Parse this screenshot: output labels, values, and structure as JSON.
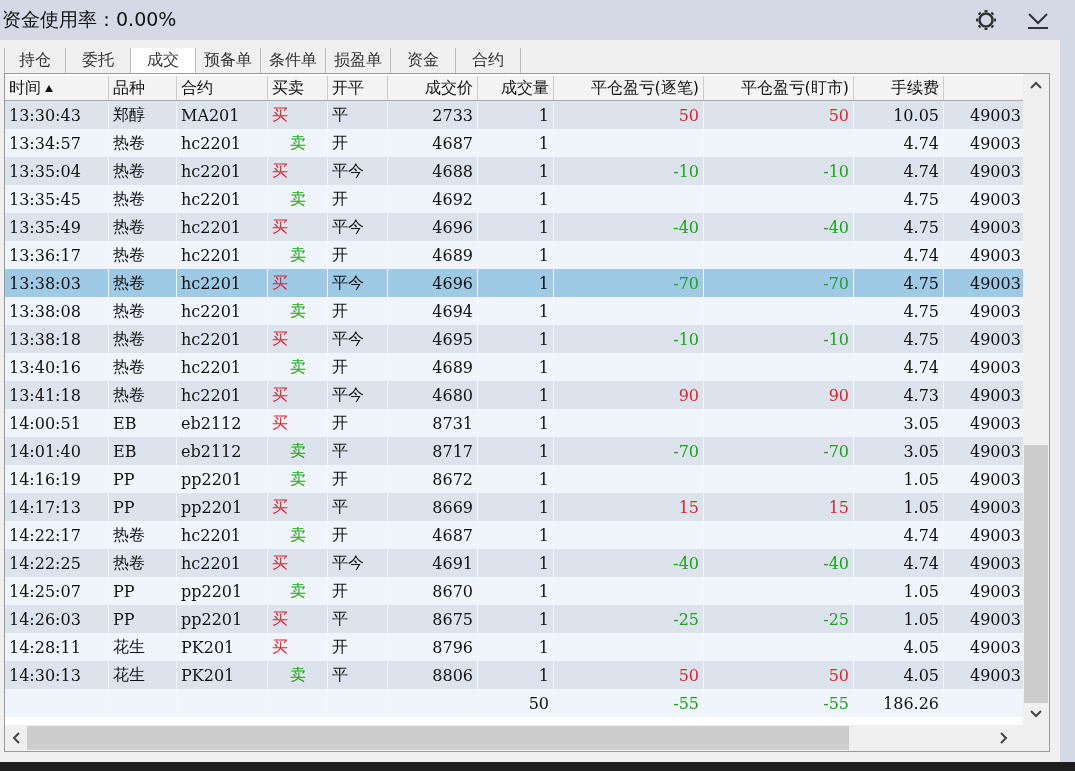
{
  "header": {
    "label": "资金使用率：",
    "value": "0.00%"
  },
  "tabs": [
    {
      "label": "持仓",
      "selected": false
    },
    {
      "label": "委托",
      "selected": false
    },
    {
      "label": "成交",
      "selected": true
    },
    {
      "label": "预备单",
      "selected": false
    },
    {
      "label": "条件单",
      "selected": false
    },
    {
      "label": "损盈单",
      "selected": false
    },
    {
      "label": "资金",
      "selected": false
    },
    {
      "label": "合约",
      "selected": false
    }
  ],
  "table": {
    "columns": [
      {
        "label": "时间",
        "sorted": true
      },
      {
        "label": "品种",
        "sorted": false
      },
      {
        "label": "合约",
        "sorted": false
      },
      {
        "label": "买卖",
        "sorted": false
      },
      {
        "label": "开平",
        "sorted": false
      },
      {
        "label": "成交价",
        "sorted": false
      },
      {
        "label": "成交量",
        "sorted": false
      },
      {
        "label": "平仓盈亏(逐笔)",
        "sorted": false
      },
      {
        "label": "平仓盈亏(盯市)",
        "sorted": false
      },
      {
        "label": "手续费",
        "sorted": false
      }
    ],
    "rows": [
      {
        "time": "13:30:43",
        "variety": "郑醇",
        "contract": "MA201",
        "side": {
          "text": "买",
          "kind": "buy"
        },
        "open_close": "平",
        "price": "2733",
        "qty": "1",
        "pnl": {
          "trade": "50",
          "mark": "50",
          "color": "#e8202a"
        },
        "fee": "10.05",
        "column_11": "49003",
        "selected": false
      },
      {
        "time": "13:34:57",
        "variety": "热卷",
        "contract": "hc2201",
        "side": {
          "text": "卖",
          "kind": "sell"
        },
        "open_close": "开",
        "price": "4687",
        "qty": "1",
        "fee": "4.74",
        "column_11": "49003",
        "selected": false
      },
      {
        "time": "13:35:04",
        "variety": "热卷",
        "contract": "hc2201",
        "side": {
          "text": "买",
          "kind": "buy"
        },
        "open_close": "平今",
        "price": "4688",
        "qty": "1",
        "pnl": {
          "trade": "-10",
          "mark": "-10",
          "color": "#1aa51a"
        },
        "fee": "4.74",
        "column_11": "49003",
        "selected": false
      },
      {
        "time": "13:35:45",
        "variety": "热卷",
        "contract": "hc2201",
        "side": {
          "text": "卖",
          "kind": "sell"
        },
        "open_close": "开",
        "price": "4692",
        "qty": "1",
        "fee": "4.75",
        "column_11": "49003",
        "selected": false
      },
      {
        "time": "13:35:49",
        "variety": "热卷",
        "contract": "hc2201",
        "side": {
          "text": "买",
          "kind": "buy"
        },
        "open_close": "平今",
        "price": "4696",
        "qty": "1",
        "pnl": {
          "trade": "-40",
          "mark": "-40",
          "color": "#1aa51a"
        },
        "fee": "4.75",
        "column_11": "49003",
        "selected": false
      },
      {
        "time": "13:36:17",
        "variety": "热卷",
        "contract": "hc2201",
        "side": {
          "text": "卖",
          "kind": "sell"
        },
        "open_close": "开",
        "price": "4689",
        "qty": "1",
        "fee": "4.74",
        "column_11": "49003",
        "selected": false
      },
      {
        "time": "13:38:03",
        "variety": "热卷",
        "contract": "hc2201",
        "side": {
          "text": "买",
          "kind": "buy"
        },
        "open_close": "平今",
        "price": "4696",
        "qty": "1",
        "pnl": {
          "trade": "-70",
          "mark": "-70",
          "color": "#1aa51a"
        },
        "fee": "4.75",
        "column_11": "49003",
        "selected": true
      },
      {
        "time": "13:38:08",
        "variety": "热卷",
        "contract": "hc2201",
        "side": {
          "text": "卖",
          "kind": "sell"
        },
        "open_close": "开",
        "price": "4694",
        "qty": "1",
        "fee": "4.75",
        "column_11": "49003",
        "selected": false
      },
      {
        "time": "13:38:18",
        "variety": "热卷",
        "contract": "hc2201",
        "side": {
          "text": "买",
          "kind": "buy"
        },
        "open_close": "平今",
        "price": "4695",
        "qty": "1",
        "pnl": {
          "trade": "-10",
          "mark": "-10",
          "color": "#1aa51a"
        },
        "fee": "4.75",
        "column_11": "49003",
        "selected": false
      },
      {
        "time": "13:40:16",
        "variety": "热卷",
        "contract": "hc2201",
        "side": {
          "text": "卖",
          "kind": "sell"
        },
        "open_close": "开",
        "price": "4689",
        "qty": "1",
        "fee": "4.74",
        "column_11": "49003",
        "selected": false
      },
      {
        "time": "13:41:18",
        "variety": "热卷",
        "contract": "hc2201",
        "side": {
          "text": "买",
          "kind": "buy"
        },
        "open_close": "平今",
        "price": "4680",
        "qty": "1",
        "pnl": {
          "trade": "90",
          "mark": "90",
          "color": "#e8202a"
        },
        "fee": "4.73",
        "column_11": "49003",
        "selected": false
      },
      {
        "time": "14:00:51",
        "variety": "EB",
        "contract": "eb2112",
        "side": {
          "text": "买",
          "kind": "buy"
        },
        "open_close": "开",
        "price": "8731",
        "qty": "1",
        "fee": "3.05",
        "column_11": "49003",
        "selected": false
      },
      {
        "time": "14:01:40",
        "variety": "EB",
        "contract": "eb2112",
        "side": {
          "text": "卖",
          "kind": "sell"
        },
        "open_close": "平",
        "price": "8717",
        "qty": "1",
        "pnl": {
          "trade": "-70",
          "mark": "-70",
          "color": "#1aa51a"
        },
        "fee": "3.05",
        "column_11": "49003",
        "selected": false
      },
      {
        "time": "14:16:19",
        "variety": "PP",
        "contract": "pp2201",
        "side": {
          "text": "卖",
          "kind": "sell"
        },
        "open_close": "开",
        "price": "8672",
        "qty": "1",
        "fee": "1.05",
        "column_11": "49003",
        "selected": false
      },
      {
        "time": "14:17:13",
        "variety": "PP",
        "contract": "pp2201",
        "side": {
          "text": "买",
          "kind": "buy"
        },
        "open_close": "平",
        "price": "8669",
        "qty": "1",
        "pnl": {
          "trade": "15",
          "mark": "15",
          "color": "#e8202a"
        },
        "fee": "1.05",
        "column_11": "49003",
        "selected": false
      },
      {
        "time": "14:22:17",
        "variety": "热卷",
        "contract": "hc2201",
        "side": {
          "text": "卖",
          "kind": "sell"
        },
        "open_close": "开",
        "price": "4687",
        "qty": "1",
        "fee": "4.74",
        "column_11": "49003",
        "selected": false
      },
      {
        "time": "14:22:25",
        "variety": "热卷",
        "contract": "hc2201",
        "side": {
          "text": "买",
          "kind": "buy"
        },
        "open_close": "平今",
        "price": "4691",
        "qty": "1",
        "pnl": {
          "trade": "-40",
          "mark": "-40",
          "color": "#1aa51a"
        },
        "fee": "4.74",
        "column_11": "49003",
        "selected": false
      },
      {
        "time": "14:25:07",
        "variety": "PP",
        "contract": "pp2201",
        "side": {
          "text": "卖",
          "kind": "sell"
        },
        "open_close": "开",
        "price": "8670",
        "qty": "1",
        "fee": "1.05",
        "column_11": "49003",
        "selected": false
      },
      {
        "time": "14:26:03",
        "variety": "PP",
        "contract": "pp2201",
        "side": {
          "text": "买",
          "kind": "buy"
        },
        "open_close": "平",
        "price": "8675",
        "qty": "1",
        "pnl": {
          "trade": "-25",
          "mark": "-25",
          "color": "#1aa51a"
        },
        "fee": "1.05",
        "column_11": "49003",
        "selected": false
      },
      {
        "time": "14:28:11",
        "variety": "花生",
        "contract": "PK201",
        "side": {
          "text": "买",
          "kind": "buy"
        },
        "open_close": "开",
        "price": "8796",
        "qty": "1",
        "fee": "4.05",
        "column_11": "49003",
        "selected": false
      },
      {
        "time": "14:30:13",
        "variety": "花生",
        "contract": "PK201",
        "side": {
          "text": "卖",
          "kind": "sell"
        },
        "open_close": "平",
        "price": "8806",
        "qty": "1",
        "pnl": {
          "trade": "50",
          "mark": "50",
          "color": "#e8202a"
        },
        "fee": "4.05",
        "column_11": "49003",
        "selected": false
      }
    ],
    "totals": {
      "qty": "50",
      "pnl": {
        "trade": "-55",
        "mark": "-55",
        "color": "#1aa51a"
      },
      "fee": "186.26"
    }
  }
}
